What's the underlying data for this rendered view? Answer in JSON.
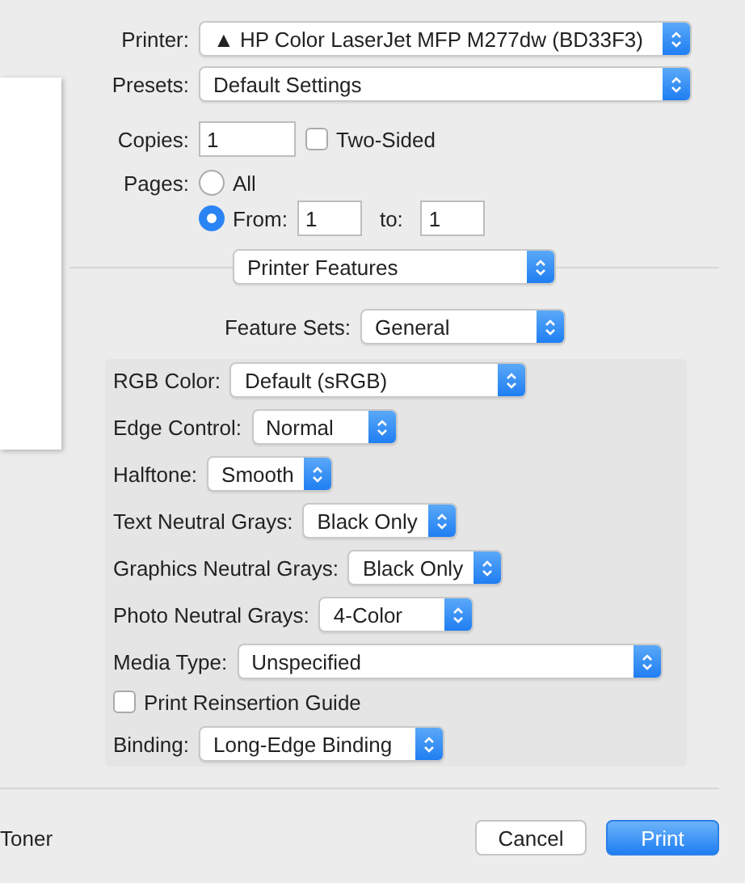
{
  "printer": {
    "label": "Printer:",
    "value": "▲ HP Color LaserJet MFP M277dw (BD33F3)"
  },
  "presets": {
    "label": "Presets:",
    "value": "Default Settings"
  },
  "copies": {
    "label": "Copies:",
    "value": "1"
  },
  "two_sided": {
    "label": "Two-Sided",
    "checked": false
  },
  "pages": {
    "label": "Pages:",
    "options": [
      {
        "label": "All",
        "selected": false
      },
      {
        "label": "From:",
        "selected": true
      }
    ],
    "from": "1",
    "to_label": "to:",
    "to": "1"
  },
  "section": {
    "value": "Printer Features"
  },
  "feature_sets": {
    "label": "Feature Sets:",
    "value": "General"
  },
  "features": [
    {
      "kind": "popup",
      "label": "RGB Color:",
      "value": "Default (sRGB)"
    },
    {
      "kind": "popup",
      "label": "Edge Control:",
      "value": "Normal"
    },
    {
      "kind": "popup",
      "label": "Halftone:",
      "value": "Smooth"
    },
    {
      "kind": "popup",
      "label": "Text Neutral Grays:",
      "value": "Black Only"
    },
    {
      "kind": "popup",
      "label": "Graphics Neutral Grays:",
      "value": "Black Only"
    },
    {
      "kind": "popup",
      "label": "Photo Neutral Grays:",
      "value": "4-Color"
    },
    {
      "kind": "popup",
      "label": "Media Type:",
      "value": "Unspecified"
    },
    {
      "kind": "checkbox",
      "label": "Print Reinsertion Guide",
      "checked": false
    },
    {
      "kind": "popup",
      "label": "Binding:",
      "value": "Long-Edge Binding"
    }
  ],
  "footer": {
    "status": "Toner",
    "buttons": [
      {
        "label": "Cancel",
        "kind": "secondary"
      },
      {
        "label": "Print",
        "kind": "primary"
      }
    ]
  }
}
